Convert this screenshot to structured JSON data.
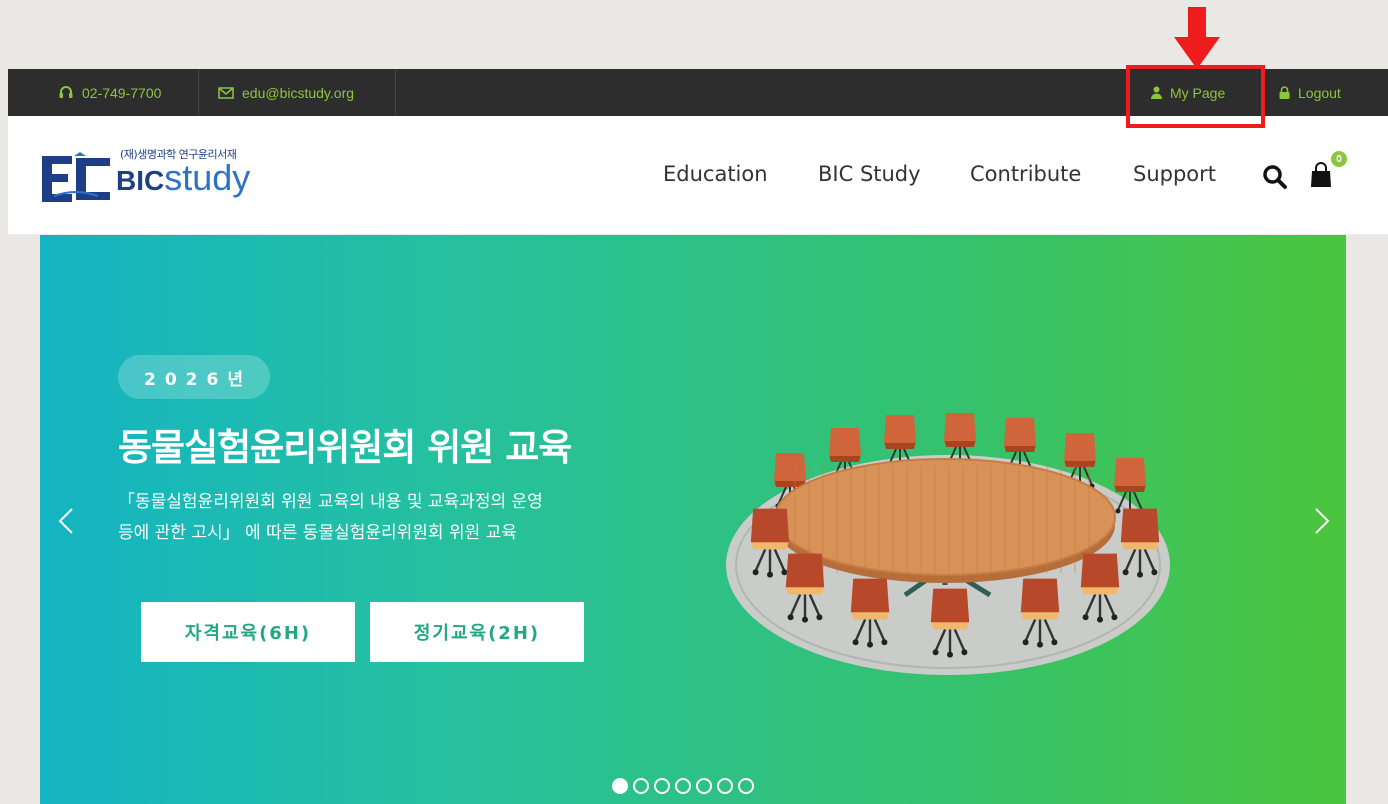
{
  "topbar": {
    "phone": "02-749-7700",
    "email": "edu@bicstudy.org",
    "my_page": "My Page",
    "logout": "Logout"
  },
  "logo": {
    "sub": "(재)생명과학 연구윤리서재",
    "bic": "BIC",
    "study": "study"
  },
  "nav": {
    "items": [
      "Education",
      "BIC Study",
      "Contribute",
      "Support"
    ],
    "cart_count": "0"
  },
  "hero": {
    "year": "2026년",
    "title": "동물실험윤리위원회 위원 교육",
    "description": "「동물실험윤리위원회 위원 교육의 내용 및 교육과정의 운영\n등에 관한 고시」 에 따른 동물실험윤리위원회 위원 교육",
    "buttons": [
      "자격교육(6H)",
      "정기교육(2H)"
    ],
    "slide_count": 7,
    "active_slide": 1
  },
  "icons": {
    "phone": "headset-icon",
    "email": "envelope-icon",
    "my_page": "user-icon",
    "logout": "lock-icon",
    "search": "search-icon",
    "cart": "shopping-bag-icon",
    "prev": "chevron-left-icon",
    "next": "chevron-right-icon"
  },
  "colors": {
    "accent": "#8cc63f",
    "topbar_bg": "#2d2d2d",
    "brand_blue": "#1e3f87",
    "hero_start": "#14b4c3",
    "hero_end": "#4bc53d",
    "annotation": "#ee1c1c"
  }
}
